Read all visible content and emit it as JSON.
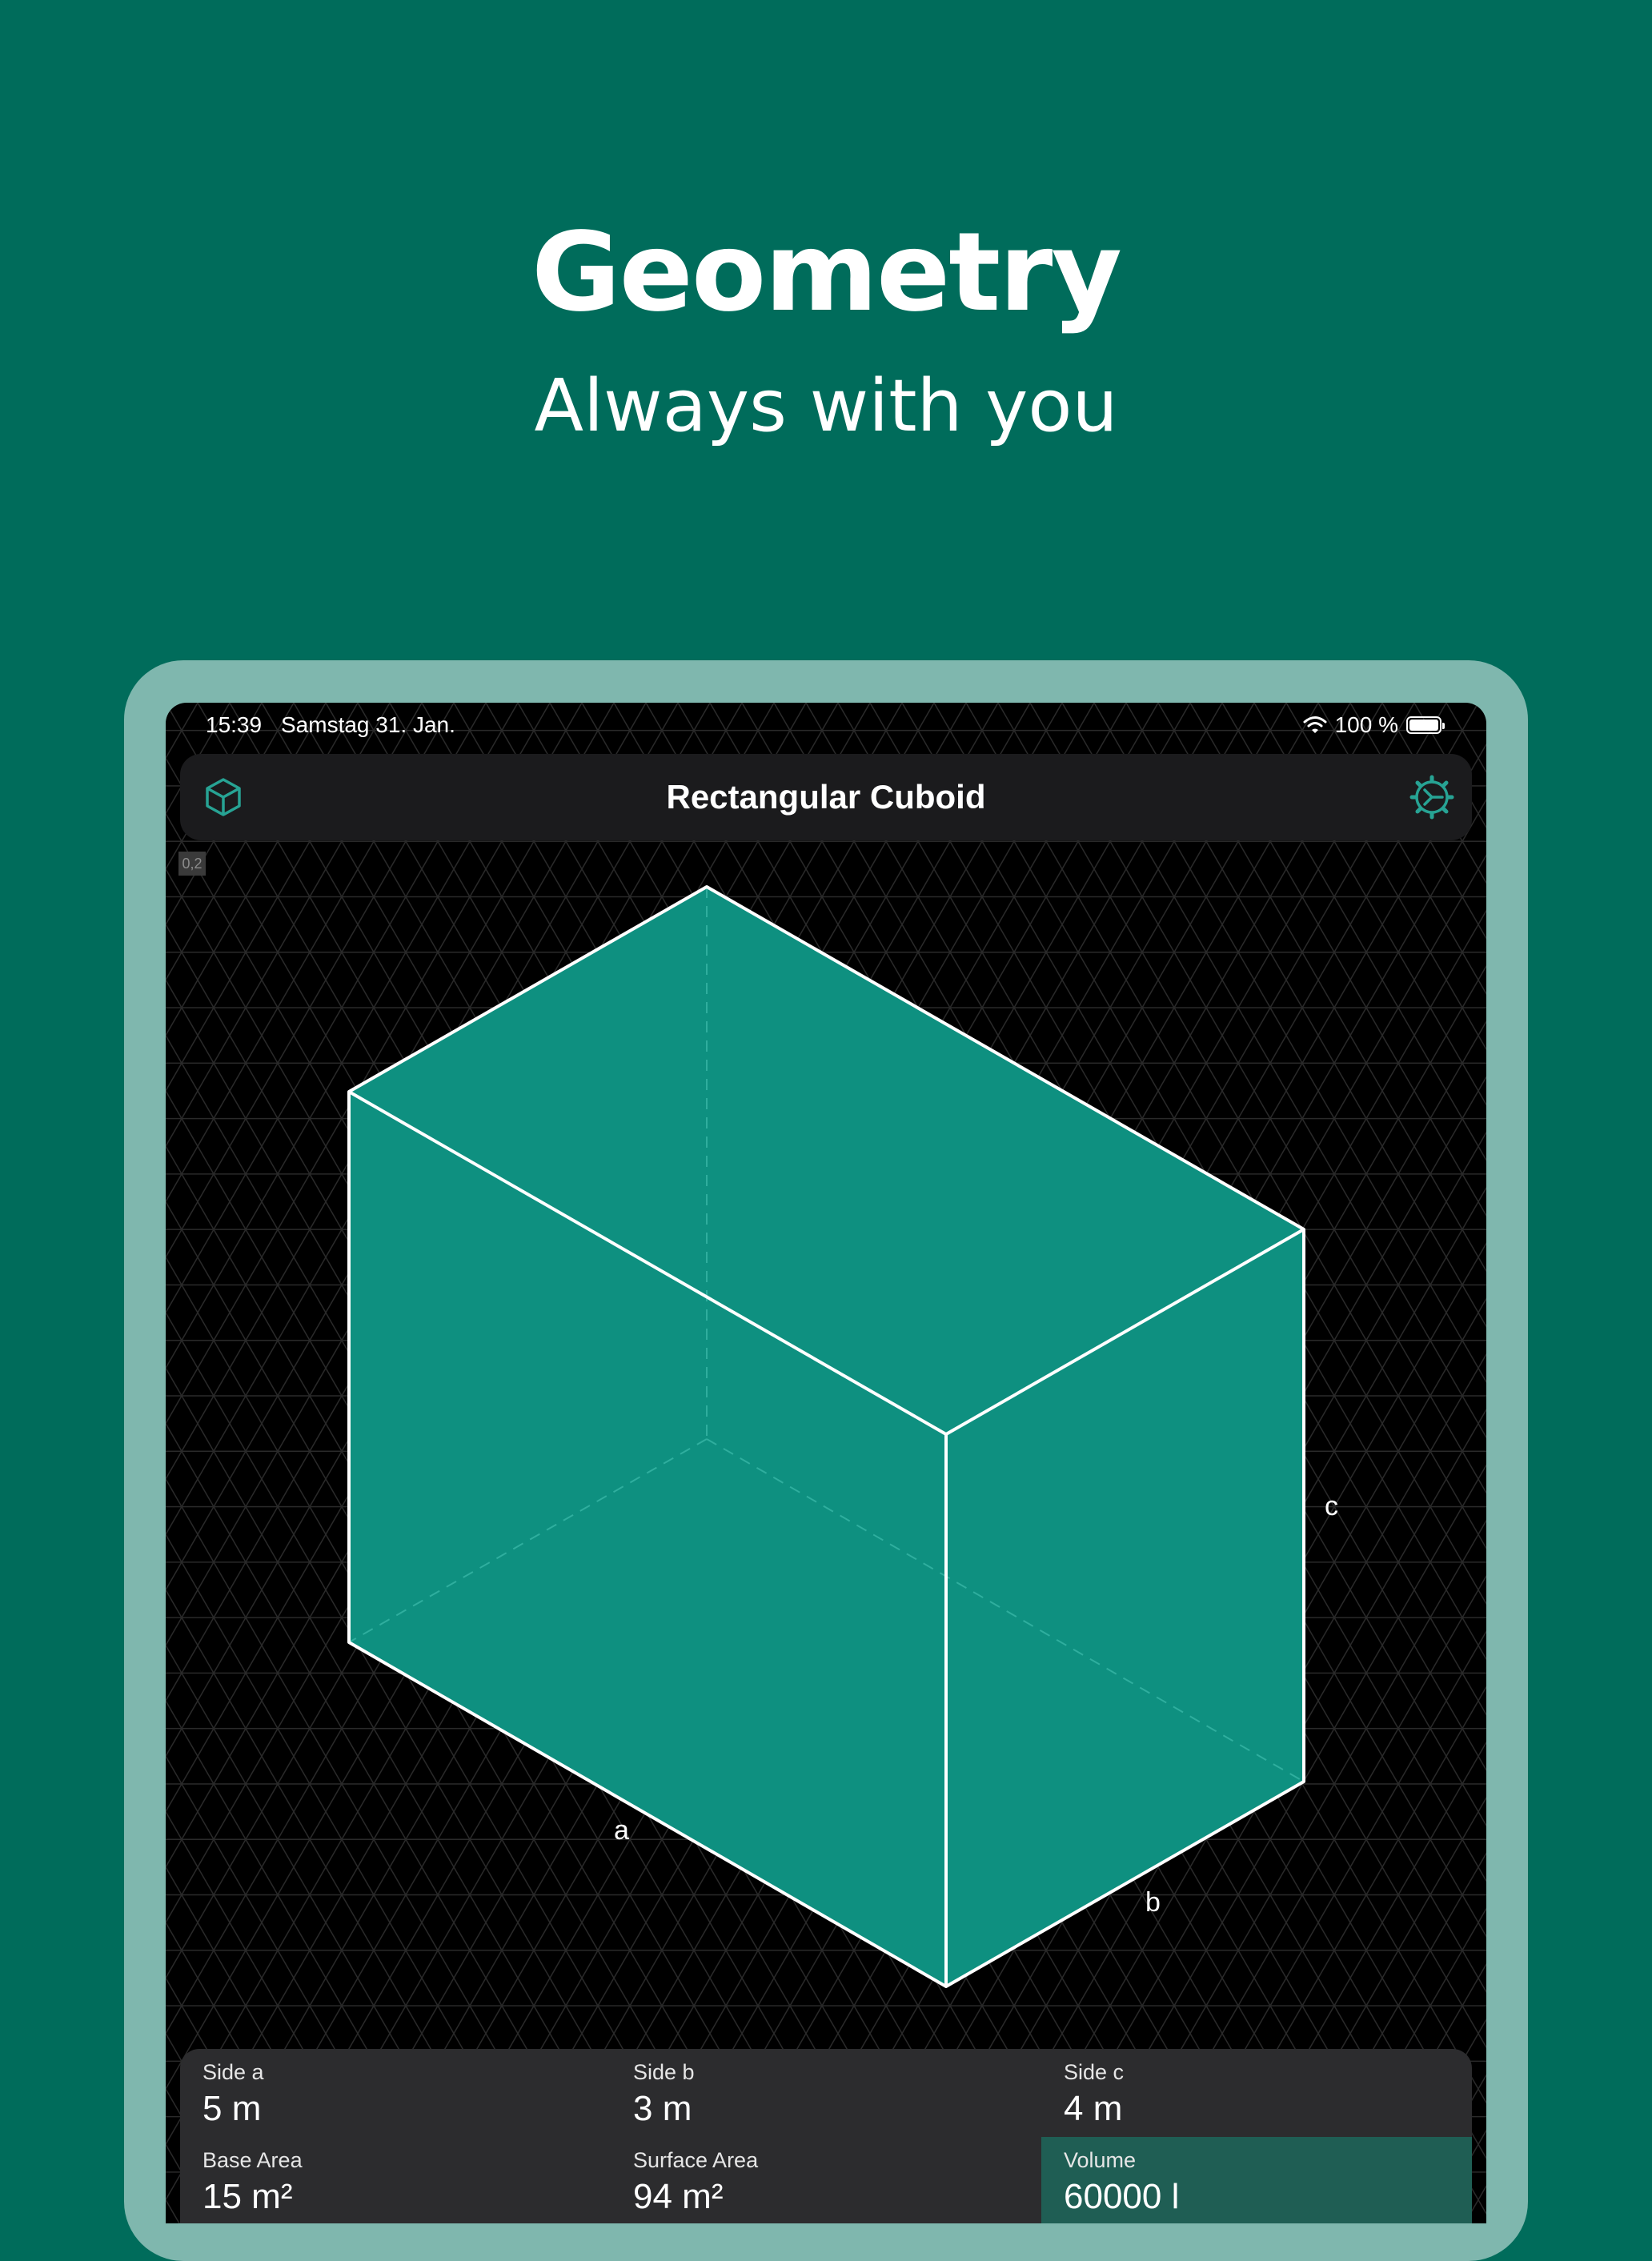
{
  "hero": {
    "title": "Geometry",
    "subtitle": "Always with you"
  },
  "status_bar": {
    "time": "15:39",
    "date": "Samstag 31. Jan.",
    "battery": "100 %",
    "wifi_icon": "wifi-icon",
    "battery_icon": "battery-icon"
  },
  "nav": {
    "title": "Rectangular Cuboid",
    "left_icon": "cube-icon",
    "right_icon": "settings-gear-icon"
  },
  "canvas": {
    "scale_badge": "0,2",
    "label_a": "a",
    "label_b": "b",
    "label_c": "c",
    "shape_color": "#0e9080",
    "edge_color": "#ffffff"
  },
  "results": {
    "side_a": {
      "label": "Side a",
      "value": "5 m"
    },
    "side_b": {
      "label": "Side b",
      "value": "3 m"
    },
    "side_c": {
      "label": "Side c",
      "value": "4 m"
    },
    "base_area": {
      "label": "Base Area",
      "value": "15 m²"
    },
    "surface_area": {
      "label": "Surface Area",
      "value": "94 m²"
    },
    "volume": {
      "label": "Volume",
      "value": "60000 l"
    }
  },
  "colors": {
    "background": "#006c5b",
    "frame": "#7fb7ae",
    "accent": "#0e9080",
    "highlight_cell": "#1f5e54"
  }
}
